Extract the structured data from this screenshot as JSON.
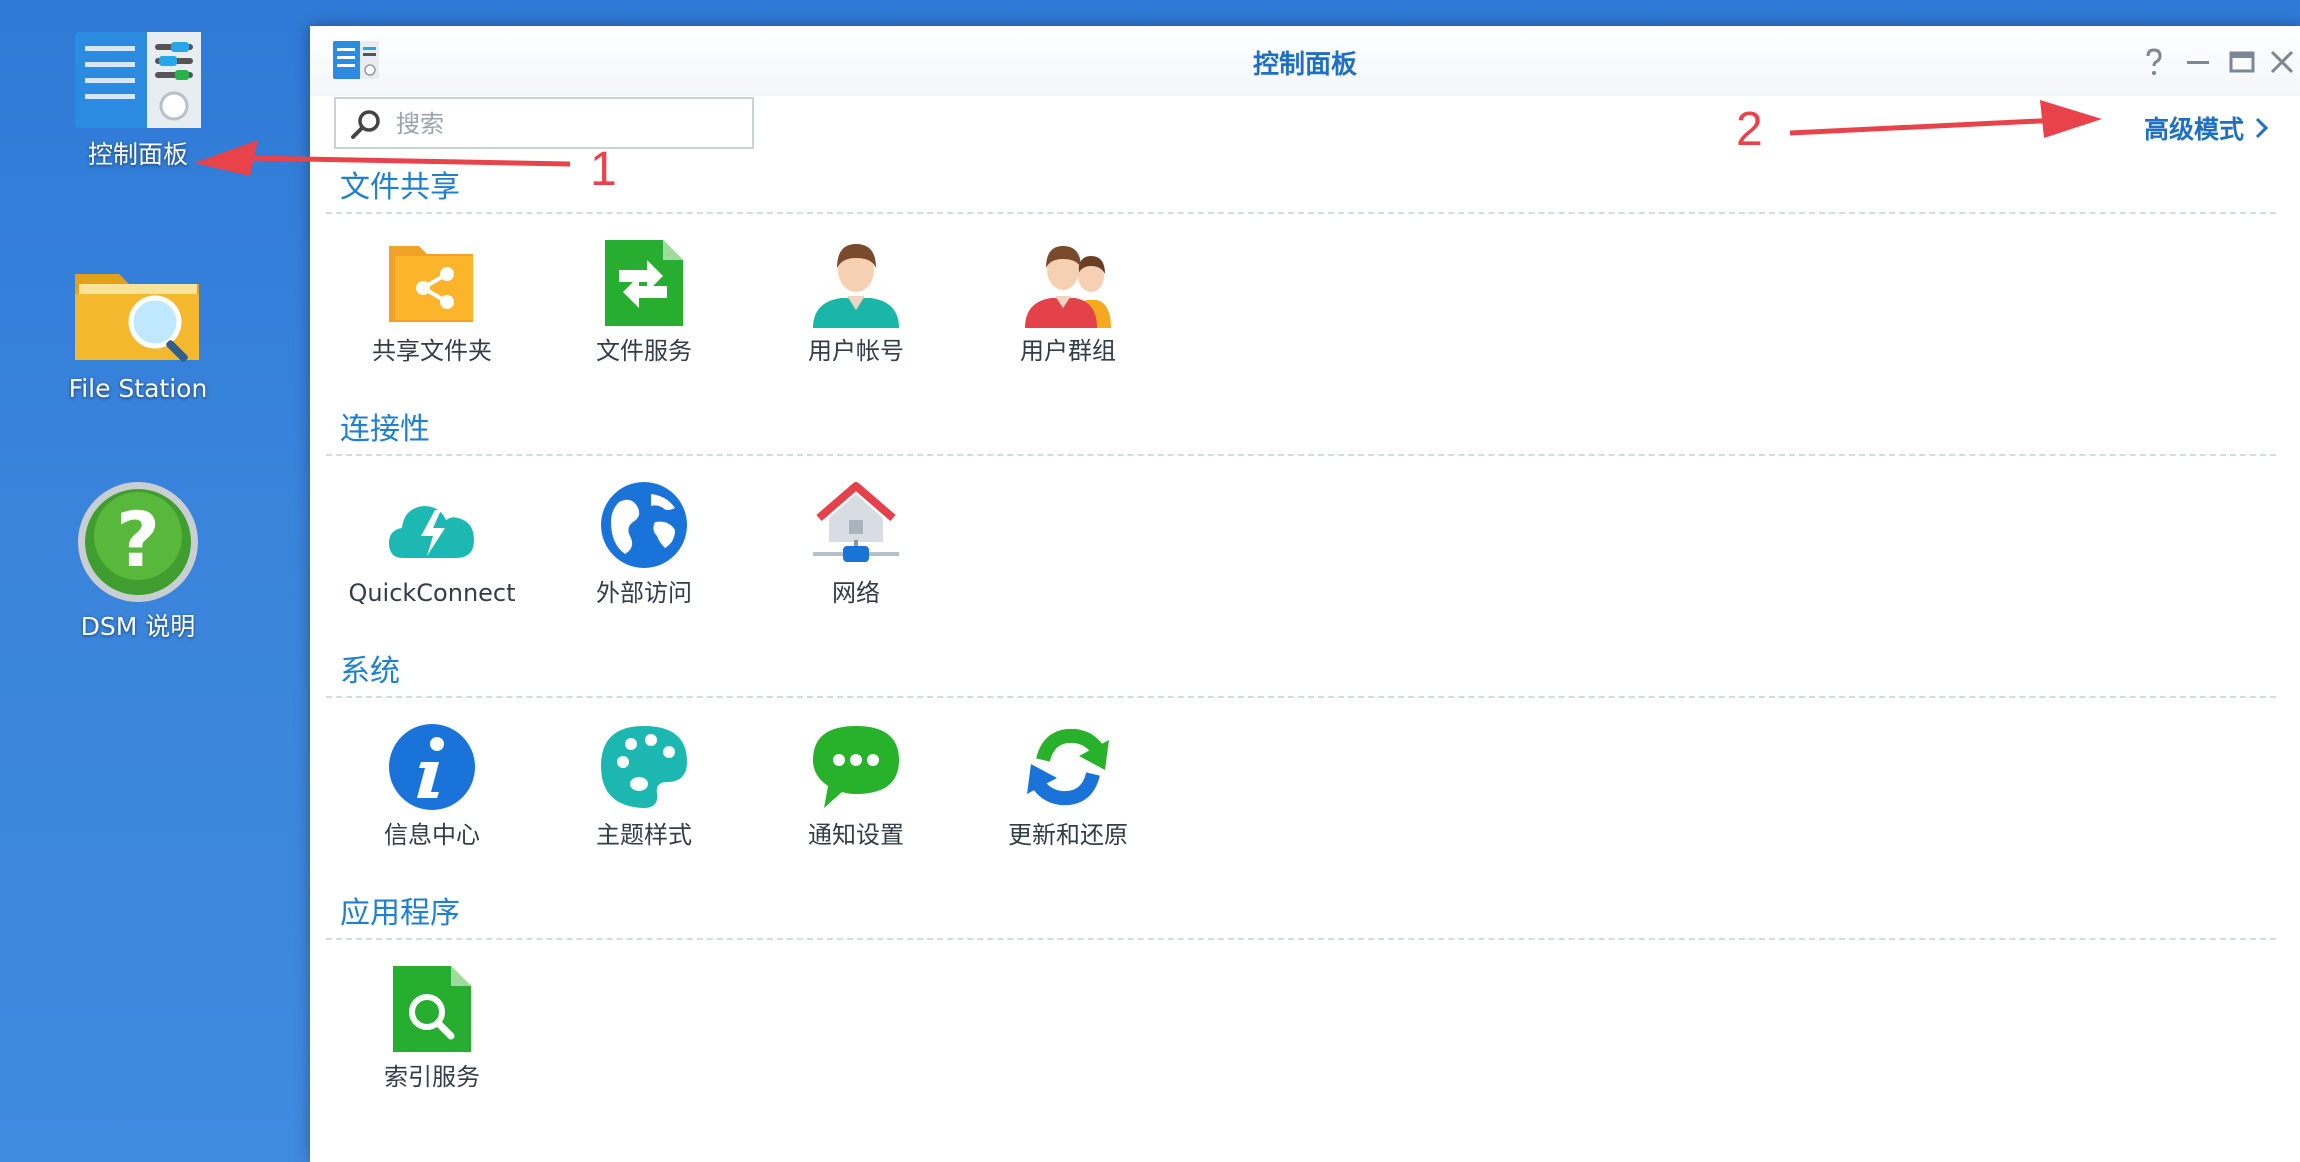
{
  "desktop": {
    "icons": [
      {
        "label": "控制面板",
        "icon": "control-panel-icon"
      },
      {
        "label": "File Station",
        "icon": "folder-search-icon"
      },
      {
        "label": "DSM 说明",
        "icon": "help-icon"
      }
    ]
  },
  "window": {
    "title": "控制面板",
    "buttons": {
      "help": "help-icon",
      "minimize": "minimize-icon",
      "maximize": "maximize-icon",
      "close": "close-icon"
    }
  },
  "search": {
    "placeholder": "搜索",
    "value": ""
  },
  "advanced_mode": {
    "label": "高级模式"
  },
  "sections": [
    {
      "title": "文件共享",
      "items": [
        {
          "label": "共享文件夹",
          "icon": "shared-folder-icon"
        },
        {
          "label": "文件服务",
          "icon": "file-services-icon"
        },
        {
          "label": "用户帐号",
          "icon": "user-icon"
        },
        {
          "label": "用户群组",
          "icon": "user-group-icon"
        }
      ]
    },
    {
      "title": "连接性",
      "items": [
        {
          "label": "QuickConnect",
          "icon": "quickconnect-icon"
        },
        {
          "label": "外部访问",
          "icon": "globe-icon"
        },
        {
          "label": "网络",
          "icon": "network-house-icon"
        }
      ]
    },
    {
      "title": "系统",
      "items": [
        {
          "label": "信息中心",
          "icon": "info-icon"
        },
        {
          "label": "主题样式",
          "icon": "palette-icon"
        },
        {
          "label": "通知设置",
          "icon": "chat-bubble-icon"
        },
        {
          "label": "更新和还原",
          "icon": "refresh-icon"
        }
      ]
    },
    {
      "title": "应用程序",
      "items": [
        {
          "label": "索引服务",
          "icon": "index-search-icon"
        }
      ]
    }
  ],
  "annotations": [
    {
      "label": "1"
    },
    {
      "label": "2"
    }
  ],
  "colors": {
    "accent": "#1f7fd1",
    "annotation": "#e8434b",
    "desktop": "#3a84dc"
  }
}
